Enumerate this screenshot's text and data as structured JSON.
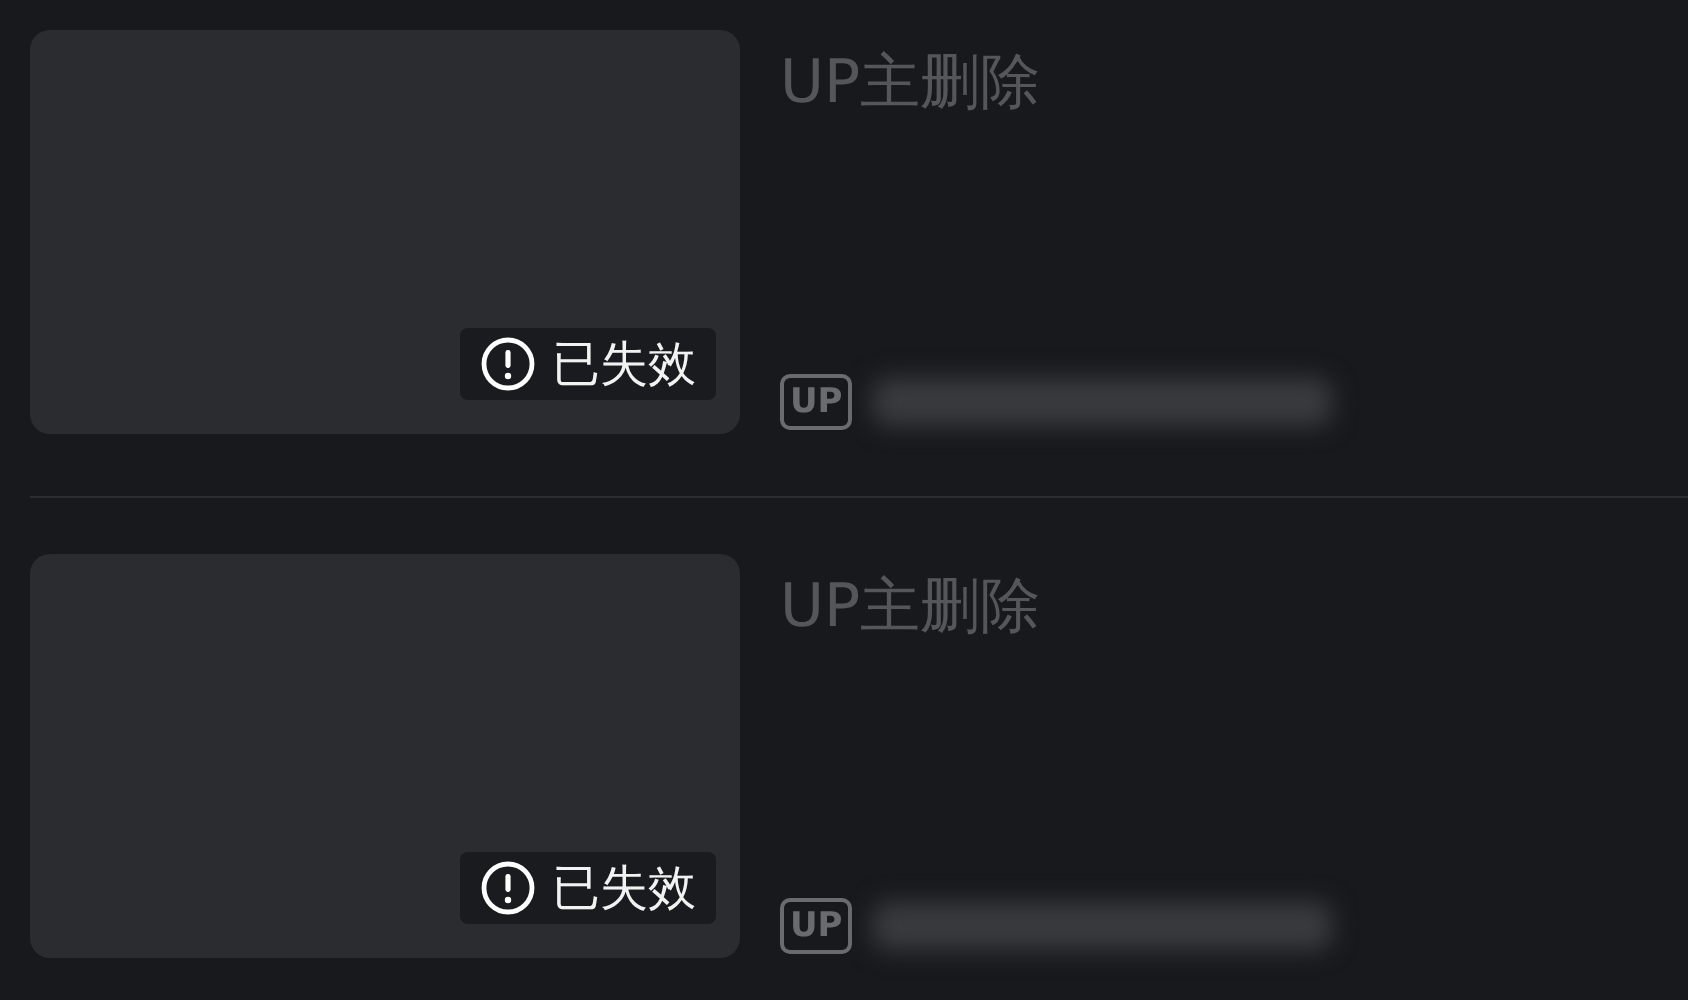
{
  "items": [
    {
      "title": "UP主删除",
      "badge": "已失效",
      "up_label": "UP"
    },
    {
      "title": "UP主删除",
      "badge": "已失效",
      "up_label": "UP"
    }
  ]
}
